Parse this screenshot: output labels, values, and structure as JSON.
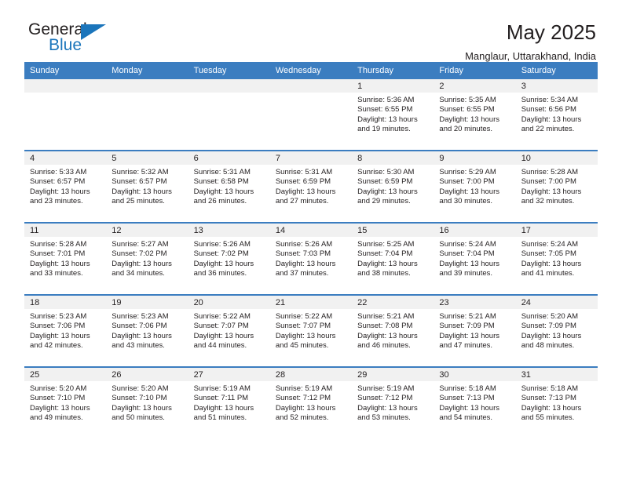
{
  "brand": {
    "name_top": "General",
    "name_bottom": "Blue",
    "triangle_color": "#1b75bb",
    "text_color": "#231f20"
  },
  "header": {
    "title": "May 2025",
    "subtitle": "Manglaur, Uttarakhand, India"
  },
  "calendar": {
    "header_bg": "#3b7dc0",
    "header_text_color": "#ffffff",
    "daynum_bg": "#f1f1f1",
    "weekdays": [
      "Sunday",
      "Monday",
      "Tuesday",
      "Wednesday",
      "Thursday",
      "Friday",
      "Saturday"
    ],
    "weeks": [
      [
        {
          "day": "",
          "sunrise": "",
          "sunset": "",
          "daylight1": "",
          "daylight2": "",
          "empty": true
        },
        {
          "day": "",
          "sunrise": "",
          "sunset": "",
          "daylight1": "",
          "daylight2": "",
          "empty": true
        },
        {
          "day": "",
          "sunrise": "",
          "sunset": "",
          "daylight1": "",
          "daylight2": "",
          "empty": true
        },
        {
          "day": "",
          "sunrise": "",
          "sunset": "",
          "daylight1": "",
          "daylight2": "",
          "empty": true
        },
        {
          "day": "1",
          "sunrise": "Sunrise: 5:36 AM",
          "sunset": "Sunset: 6:55 PM",
          "daylight1": "Daylight: 13 hours",
          "daylight2": "and 19 minutes."
        },
        {
          "day": "2",
          "sunrise": "Sunrise: 5:35 AM",
          "sunset": "Sunset: 6:55 PM",
          "daylight1": "Daylight: 13 hours",
          "daylight2": "and 20 minutes."
        },
        {
          "day": "3",
          "sunrise": "Sunrise: 5:34 AM",
          "sunset": "Sunset: 6:56 PM",
          "daylight1": "Daylight: 13 hours",
          "daylight2": "and 22 minutes."
        }
      ],
      [
        {
          "day": "4",
          "sunrise": "Sunrise: 5:33 AM",
          "sunset": "Sunset: 6:57 PM",
          "daylight1": "Daylight: 13 hours",
          "daylight2": "and 23 minutes."
        },
        {
          "day": "5",
          "sunrise": "Sunrise: 5:32 AM",
          "sunset": "Sunset: 6:57 PM",
          "daylight1": "Daylight: 13 hours",
          "daylight2": "and 25 minutes."
        },
        {
          "day": "6",
          "sunrise": "Sunrise: 5:31 AM",
          "sunset": "Sunset: 6:58 PM",
          "daylight1": "Daylight: 13 hours",
          "daylight2": "and 26 minutes."
        },
        {
          "day": "7",
          "sunrise": "Sunrise: 5:31 AM",
          "sunset": "Sunset: 6:59 PM",
          "daylight1": "Daylight: 13 hours",
          "daylight2": "and 27 minutes."
        },
        {
          "day": "8",
          "sunrise": "Sunrise: 5:30 AM",
          "sunset": "Sunset: 6:59 PM",
          "daylight1": "Daylight: 13 hours",
          "daylight2": "and 29 minutes."
        },
        {
          "day": "9",
          "sunrise": "Sunrise: 5:29 AM",
          "sunset": "Sunset: 7:00 PM",
          "daylight1": "Daylight: 13 hours",
          "daylight2": "and 30 minutes."
        },
        {
          "day": "10",
          "sunrise": "Sunrise: 5:28 AM",
          "sunset": "Sunset: 7:00 PM",
          "daylight1": "Daylight: 13 hours",
          "daylight2": "and 32 minutes."
        }
      ],
      [
        {
          "day": "11",
          "sunrise": "Sunrise: 5:28 AM",
          "sunset": "Sunset: 7:01 PM",
          "daylight1": "Daylight: 13 hours",
          "daylight2": "and 33 minutes."
        },
        {
          "day": "12",
          "sunrise": "Sunrise: 5:27 AM",
          "sunset": "Sunset: 7:02 PM",
          "daylight1": "Daylight: 13 hours",
          "daylight2": "and 34 minutes."
        },
        {
          "day": "13",
          "sunrise": "Sunrise: 5:26 AM",
          "sunset": "Sunset: 7:02 PM",
          "daylight1": "Daylight: 13 hours",
          "daylight2": "and 36 minutes."
        },
        {
          "day": "14",
          "sunrise": "Sunrise: 5:26 AM",
          "sunset": "Sunset: 7:03 PM",
          "daylight1": "Daylight: 13 hours",
          "daylight2": "and 37 minutes."
        },
        {
          "day": "15",
          "sunrise": "Sunrise: 5:25 AM",
          "sunset": "Sunset: 7:04 PM",
          "daylight1": "Daylight: 13 hours",
          "daylight2": "and 38 minutes."
        },
        {
          "day": "16",
          "sunrise": "Sunrise: 5:24 AM",
          "sunset": "Sunset: 7:04 PM",
          "daylight1": "Daylight: 13 hours",
          "daylight2": "and 39 minutes."
        },
        {
          "day": "17",
          "sunrise": "Sunrise: 5:24 AM",
          "sunset": "Sunset: 7:05 PM",
          "daylight1": "Daylight: 13 hours",
          "daylight2": "and 41 minutes."
        }
      ],
      [
        {
          "day": "18",
          "sunrise": "Sunrise: 5:23 AM",
          "sunset": "Sunset: 7:06 PM",
          "daylight1": "Daylight: 13 hours",
          "daylight2": "and 42 minutes."
        },
        {
          "day": "19",
          "sunrise": "Sunrise: 5:23 AM",
          "sunset": "Sunset: 7:06 PM",
          "daylight1": "Daylight: 13 hours",
          "daylight2": "and 43 minutes."
        },
        {
          "day": "20",
          "sunrise": "Sunrise: 5:22 AM",
          "sunset": "Sunset: 7:07 PM",
          "daylight1": "Daylight: 13 hours",
          "daylight2": "and 44 minutes."
        },
        {
          "day": "21",
          "sunrise": "Sunrise: 5:22 AM",
          "sunset": "Sunset: 7:07 PM",
          "daylight1": "Daylight: 13 hours",
          "daylight2": "and 45 minutes."
        },
        {
          "day": "22",
          "sunrise": "Sunrise: 5:21 AM",
          "sunset": "Sunset: 7:08 PM",
          "daylight1": "Daylight: 13 hours",
          "daylight2": "and 46 minutes."
        },
        {
          "day": "23",
          "sunrise": "Sunrise: 5:21 AM",
          "sunset": "Sunset: 7:09 PM",
          "daylight1": "Daylight: 13 hours",
          "daylight2": "and 47 minutes."
        },
        {
          "day": "24",
          "sunrise": "Sunrise: 5:20 AM",
          "sunset": "Sunset: 7:09 PM",
          "daylight1": "Daylight: 13 hours",
          "daylight2": "and 48 minutes."
        }
      ],
      [
        {
          "day": "25",
          "sunrise": "Sunrise: 5:20 AM",
          "sunset": "Sunset: 7:10 PM",
          "daylight1": "Daylight: 13 hours",
          "daylight2": "and 49 minutes."
        },
        {
          "day": "26",
          "sunrise": "Sunrise: 5:20 AM",
          "sunset": "Sunset: 7:10 PM",
          "daylight1": "Daylight: 13 hours",
          "daylight2": "and 50 minutes."
        },
        {
          "day": "27",
          "sunrise": "Sunrise: 5:19 AM",
          "sunset": "Sunset: 7:11 PM",
          "daylight1": "Daylight: 13 hours",
          "daylight2": "and 51 minutes."
        },
        {
          "day": "28",
          "sunrise": "Sunrise: 5:19 AM",
          "sunset": "Sunset: 7:12 PM",
          "daylight1": "Daylight: 13 hours",
          "daylight2": "and 52 minutes."
        },
        {
          "day": "29",
          "sunrise": "Sunrise: 5:19 AM",
          "sunset": "Sunset: 7:12 PM",
          "daylight1": "Daylight: 13 hours",
          "daylight2": "and 53 minutes."
        },
        {
          "day": "30",
          "sunrise": "Sunrise: 5:18 AM",
          "sunset": "Sunset: 7:13 PM",
          "daylight1": "Daylight: 13 hours",
          "daylight2": "and 54 minutes."
        },
        {
          "day": "31",
          "sunrise": "Sunrise: 5:18 AM",
          "sunset": "Sunset: 7:13 PM",
          "daylight1": "Daylight: 13 hours",
          "daylight2": "and 55 minutes."
        }
      ]
    ]
  }
}
